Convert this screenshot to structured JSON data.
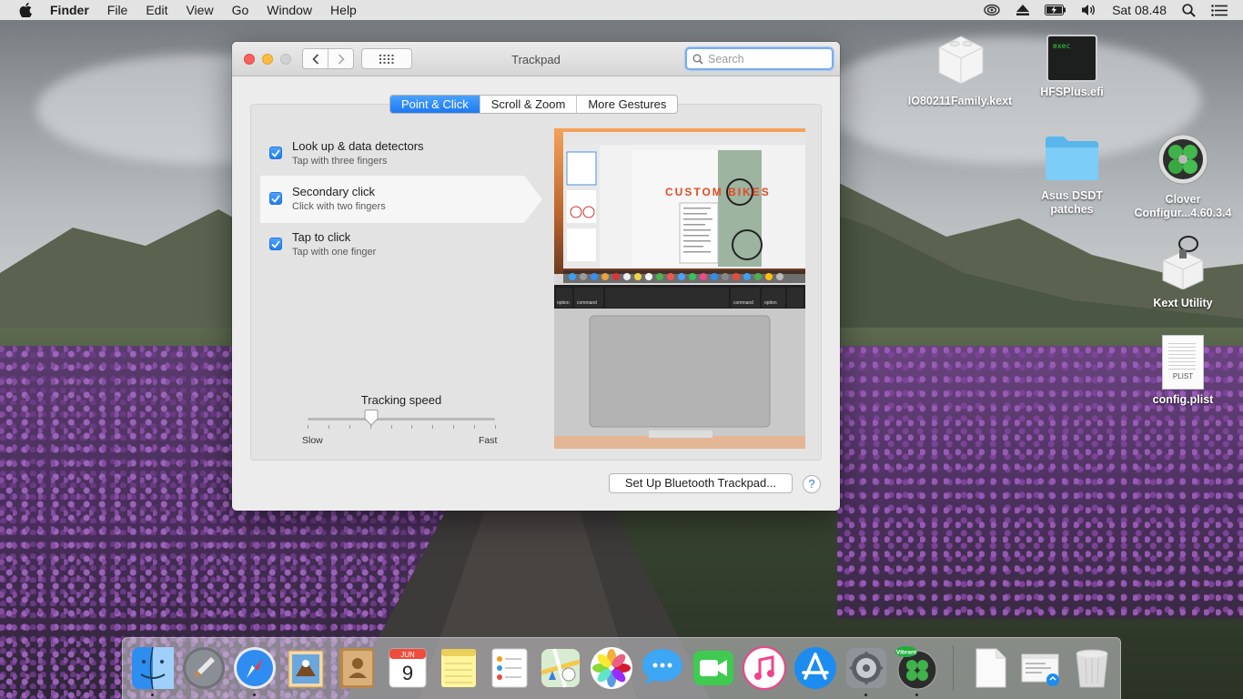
{
  "menubar": {
    "app": "Finder",
    "items": [
      "File",
      "Edit",
      "View",
      "Go",
      "Window",
      "Help"
    ],
    "clock": "Sat 08.48",
    "status_icons": [
      "wifi-icon",
      "eject-icon",
      "battery-icon",
      "volume-icon",
      "search-icon",
      "list-icon"
    ]
  },
  "desktop": {
    "icons": [
      {
        "label": "IO80211Family.kext",
        "icon": "kext-icon"
      },
      {
        "label": "HFSPlus.efi",
        "icon": "exec-icon",
        "badge": "exec"
      },
      {
        "label": "Asus DSDT patches",
        "icon": "folder-icon"
      },
      {
        "label": "Clover Configur...4.60.3.4",
        "icon": "clover-icon"
      },
      {
        "label": "Kext Utility",
        "icon": "kext-utility-icon"
      },
      {
        "label": "config.plist",
        "icon": "plist-icon",
        "badge": "PLIST"
      }
    ]
  },
  "window": {
    "title": "Trackpad",
    "search_placeholder": "Search",
    "tabs": [
      {
        "label": "Point & Click",
        "active": true
      },
      {
        "label": "Scroll & Zoom",
        "active": false
      },
      {
        "label": "More Gestures",
        "active": false
      }
    ],
    "options": [
      {
        "title": "Look up & data detectors",
        "subtitle": "Tap with three fingers",
        "checked": true,
        "selected": false
      },
      {
        "title": "Secondary click",
        "subtitle": "Click with two fingers",
        "checked": true,
        "selected": true
      },
      {
        "title": "Tap to click",
        "subtitle": "Tap with one finger",
        "checked": true,
        "selected": false
      }
    ],
    "tracking_speed": {
      "label": "Tracking speed",
      "min_label": "Slow",
      "max_label": "Fast",
      "value_fraction": 0.34,
      "ticks": 10
    },
    "preview": {
      "headline": "CUSTOM BIKES",
      "keys": [
        "option",
        "command",
        "command",
        "option"
      ]
    },
    "bluetooth_button": "Set Up Bluetooth Trackpad...",
    "help_label": "?"
  },
  "calendar": {
    "month": "JUN",
    "day": "9"
  },
  "dock": {
    "items": [
      {
        "name": "finder",
        "running": true
      },
      {
        "name": "launchpad",
        "running": false
      },
      {
        "name": "safari",
        "running": true
      },
      {
        "name": "mail",
        "running": false
      },
      {
        "name": "contacts",
        "running": false
      },
      {
        "name": "calendar",
        "running": false
      },
      {
        "name": "notes",
        "running": false
      },
      {
        "name": "reminders",
        "running": false
      },
      {
        "name": "maps",
        "running": false
      },
      {
        "name": "photos",
        "running": false
      },
      {
        "name": "messages",
        "running": false
      },
      {
        "name": "facetime",
        "running": false
      },
      {
        "name": "itunes",
        "running": false
      },
      {
        "name": "app-store",
        "running": false
      },
      {
        "name": "system-preferences",
        "running": true
      },
      {
        "name": "clover-vibrant",
        "running": true
      },
      {
        "name": "documents",
        "running": false
      },
      {
        "name": "downloads",
        "running": false
      },
      {
        "name": "trash",
        "running": false
      }
    ],
    "vibrant_label": "Vibrant"
  },
  "colors": {
    "accent": "#1d79f2",
    "menubar": "#ececec",
    "window": "#ececec"
  }
}
